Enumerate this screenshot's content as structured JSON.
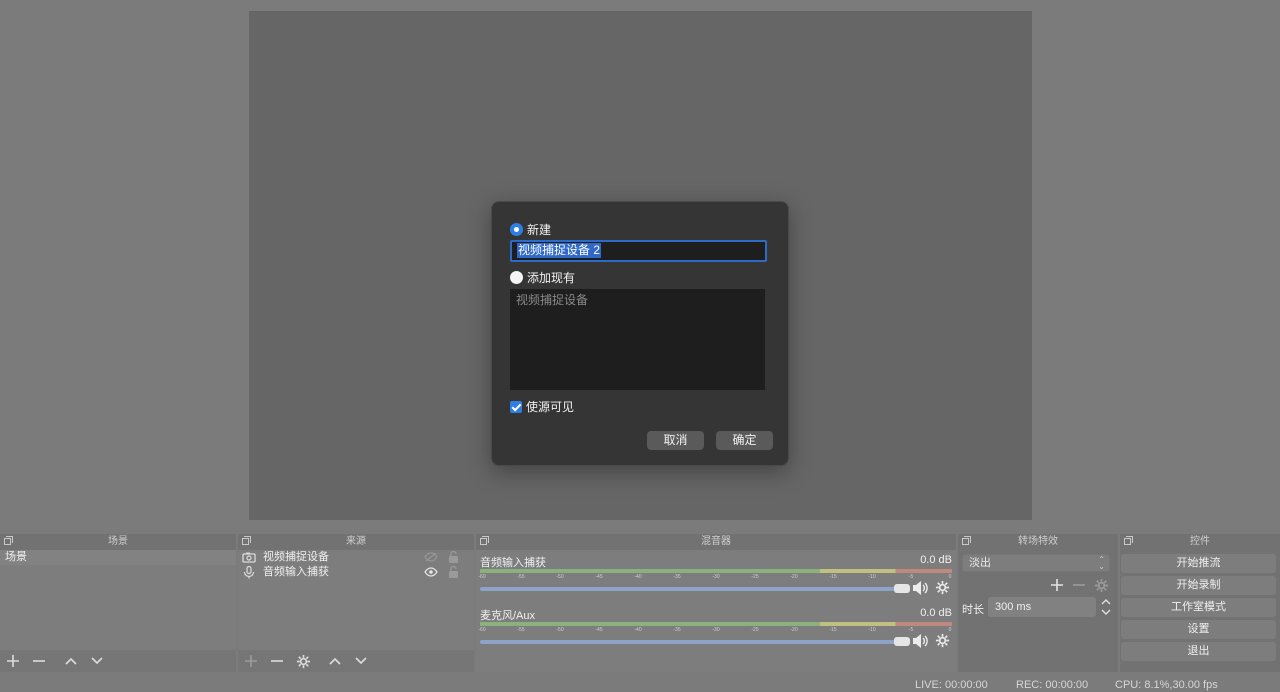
{
  "docks": {
    "scenes": {
      "title": "场景",
      "items": [
        "场景"
      ]
    },
    "sources": {
      "title": "来源",
      "items": [
        {
          "label": "视频捕捉设备",
          "icon": "camera-icon"
        },
        {
          "label": "音频输入捕获",
          "icon": "microphone-icon"
        }
      ]
    },
    "mixer": {
      "title": "混音器",
      "scale": [
        "-60",
        "-55",
        "-50",
        "-45",
        "-40",
        "-35",
        "-30",
        "-25",
        "-20",
        "-15",
        "-10",
        "-5",
        "0"
      ],
      "channels": [
        {
          "name": "音频输入捕获",
          "db": "0.0 dB"
        },
        {
          "name": "麦克风/Aux",
          "db": "0.0 dB"
        }
      ]
    },
    "transitions": {
      "title": "转场特效",
      "selected": "淡出",
      "duration_label": "时长",
      "duration_value": "300 ms"
    },
    "controls": {
      "title": "控件",
      "buttons": [
        "开始推流",
        "开始录制",
        "工作室模式",
        "设置",
        "退出"
      ]
    }
  },
  "status": {
    "live": "LIVE: 00:00:00",
    "rec": "REC: 00:00:00",
    "cpu": "CPU: 8.1%,30.00 fps"
  },
  "dialog": {
    "new_label": "新建",
    "name_value": "视频捕捉设备 2",
    "add_existing_label": "添加现有",
    "existing_items": [
      "视频捕捉设备"
    ],
    "visible_label": "使源可见",
    "cancel_label": "取消",
    "ok_label": "确定"
  },
  "colors": {
    "accent": "#2f7ee6",
    "dialog_bg": "#353535",
    "canvas": "#666666"
  }
}
